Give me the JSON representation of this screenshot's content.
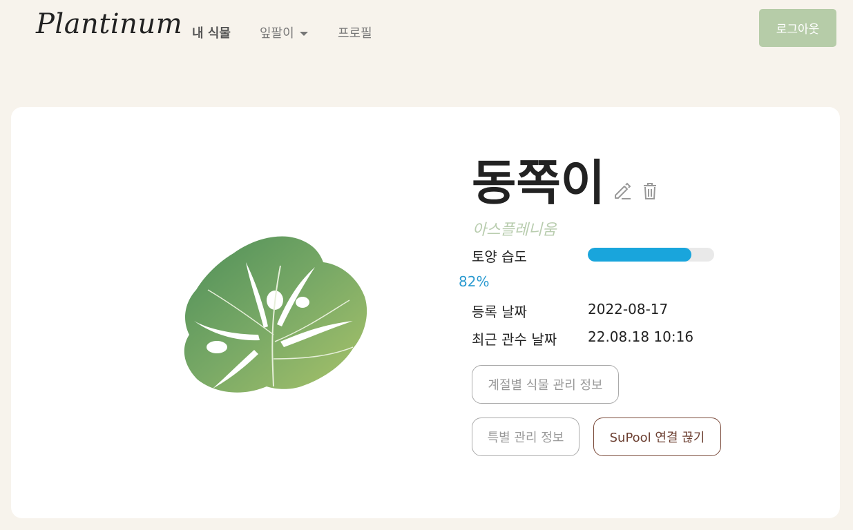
{
  "nav": {
    "logo": "Plantinum",
    "links": [
      "내 식물",
      "잎팔이",
      "프로필"
    ],
    "logout": "로그아웃"
  },
  "plant": {
    "name": "동쪽이",
    "species": "아스플레니움",
    "moisture_label": "토양 습도",
    "moisture_percent": 82,
    "moisture_text": "82%",
    "registered_label": "등록 날짜",
    "registered_value": "2022-08-17",
    "watered_label": "최근 관수 날짜",
    "watered_value": "22.08.18 10:16"
  },
  "buttons": {
    "seasonal": "계절별 식물 관리 정보",
    "special": "특별 관리 정보",
    "disconnect": "SuPool 연결 끊기"
  },
  "colors": {
    "background": "#f7f3ec",
    "accent": "#b6cca8",
    "progress": "#19a5dc",
    "species": "#b9cdaf"
  },
  "icons": [
    "pencil-icon",
    "trash-icon",
    "monstera-leaf-image"
  ]
}
